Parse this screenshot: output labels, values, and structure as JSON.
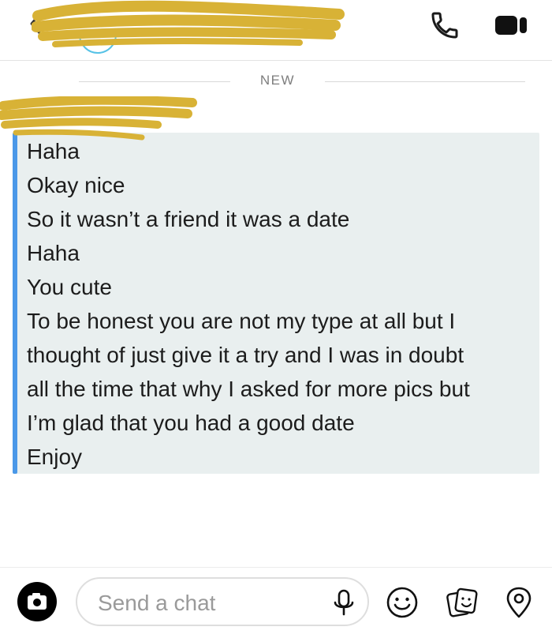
{
  "divider": {
    "label": "NEW"
  },
  "message": {
    "lines": [
      "Haha",
      "Okay nice",
      "So it wasn’t a friend it was a date",
      "Haha",
      "You cute",
      "To be honest you are not my type at all but I",
      "thought of just give it a try and I was in doubt",
      "all the time that why I asked for more pics but",
      "I’m glad that you had a good date",
      "Enjoy"
    ]
  },
  "composer": {
    "placeholder": "Send a chat"
  },
  "icons": {
    "back": "chevron-left-icon",
    "call": "phone-icon",
    "video": "video-camera-icon",
    "camera": "camera-icon",
    "mic": "microphone-icon",
    "emoji": "smiley-icon",
    "sticker": "sticker-icon",
    "location": "location-pin-icon"
  },
  "colors": {
    "accent_bar": "#4a98e8",
    "message_bg": "#e9efef",
    "redaction": "#d8b236",
    "avatar_ring": "#56c2e6"
  }
}
